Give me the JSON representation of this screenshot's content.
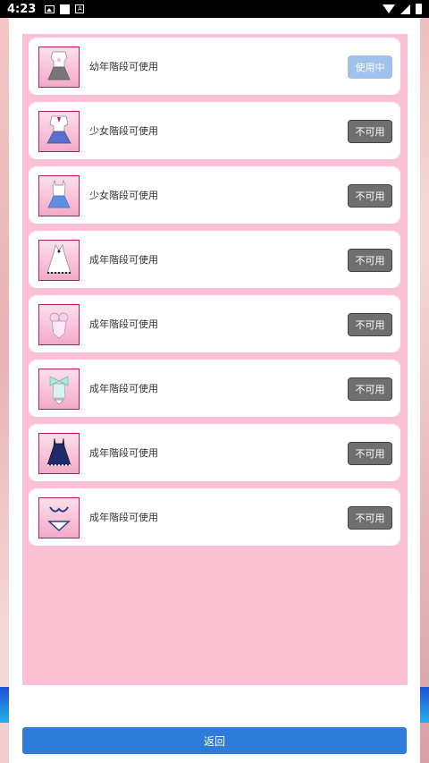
{
  "status_bar": {
    "time": "4:23"
  },
  "items": [
    {
      "label": "幼年階段可使用",
      "button": "使用中",
      "state": "in_use",
      "icon": "white-dress-icon"
    },
    {
      "label": "少女階段可使用",
      "button": "不可用",
      "state": "unavailable",
      "icon": "sailor-uniform-icon"
    },
    {
      "label": "少女階段可使用",
      "button": "不可用",
      "state": "unavailable",
      "icon": "camisole-skirt-icon"
    },
    {
      "label": "成年階段可使用",
      "button": "不可用",
      "state": "unavailable",
      "icon": "white-nightgown-icon"
    },
    {
      "label": "成年階段可使用",
      "button": "不可用",
      "state": "unavailable",
      "icon": "lingerie-icon"
    },
    {
      "label": "成年階段可使用",
      "button": "不可用",
      "state": "unavailable",
      "icon": "bow-camisole-icon"
    },
    {
      "label": "成年階段可使用",
      "button": "不可用",
      "state": "unavailable",
      "icon": "navy-dress-icon"
    },
    {
      "label": "成年階段可使用",
      "button": "不可用",
      "state": "unavailable",
      "icon": "bikini-icon"
    }
  ],
  "return_button": "返回",
  "colors": {
    "list_bg": "#fcc0d3",
    "in_use": "#9fc1ec",
    "unavailable": "#6f6f6f",
    "return": "#2f7bd9"
  }
}
